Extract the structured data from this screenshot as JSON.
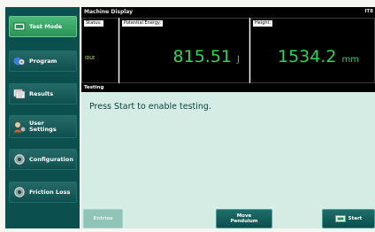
{
  "sidebar": {
    "items": [
      {
        "label": "Test Mode",
        "icon": "test-mode-icon",
        "active": true
      },
      {
        "label": "Program",
        "icon": "program-icon",
        "active": false
      },
      {
        "label": "Results",
        "icon": "results-icon",
        "active": false
      },
      {
        "label": "User Settings",
        "line1": "User",
        "line2": "Settings",
        "icon": "user-settings-icon",
        "active": false
      },
      {
        "label": "Configuration",
        "icon": "configuration-icon",
        "active": false
      },
      {
        "label": "Friction Loss",
        "icon": "friction-loss-icon",
        "active": false
      }
    ]
  },
  "header": {
    "title": "Machine Display",
    "right_text": "IT8"
  },
  "panels": {
    "status": {
      "title": "Status:",
      "value": "IDLE"
    },
    "energy": {
      "title": "Potential Energy:",
      "value": "815.51",
      "unit": "J"
    },
    "height": {
      "title": "Height:",
      "value": "1534.2",
      "unit": "mm"
    }
  },
  "section": {
    "title": "Testing",
    "message": "Press Start to enable testing."
  },
  "footer": {
    "entries_label": "Entries",
    "move_line1": "Move",
    "move_line2": "Pendulum",
    "start_label": "Start"
  },
  "colors": {
    "sidebar_bg": "#0b4f4e",
    "active_button": "#3aa86a",
    "readout_green": "#2fd35a",
    "content_bg": "#d4ece3"
  }
}
